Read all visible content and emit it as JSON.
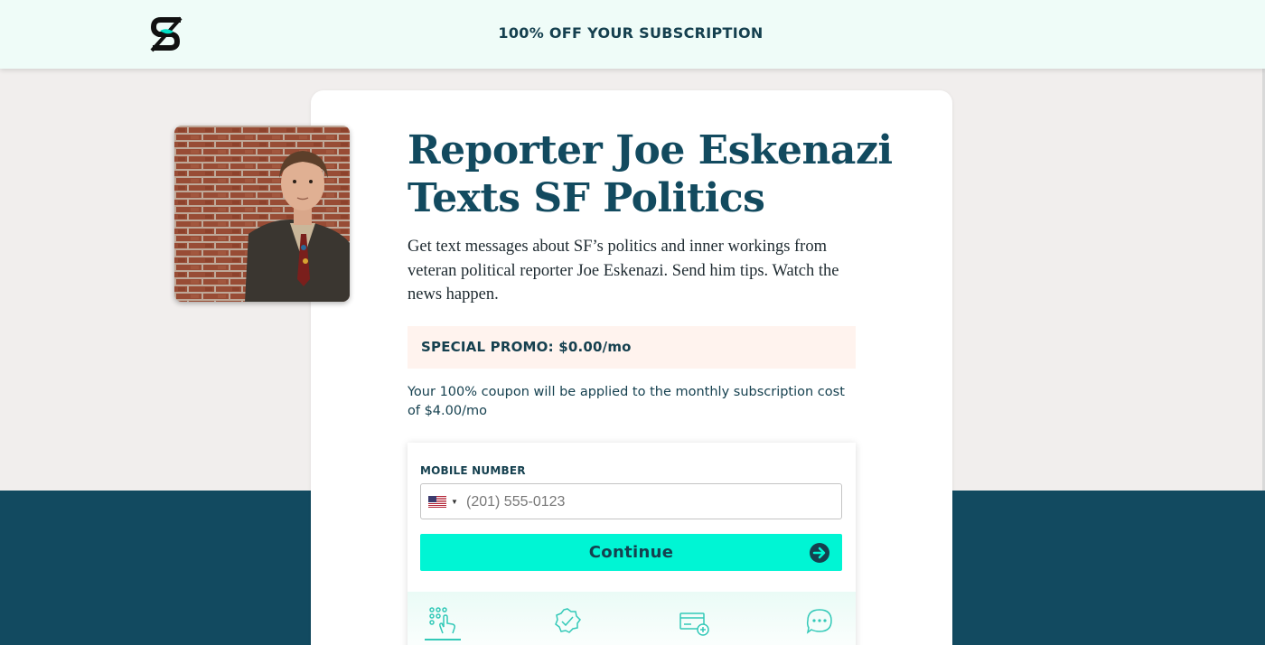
{
  "header": {
    "logo_icon": "s-logo-icon",
    "banner_text": "100% OFF YOUR SUBSCRIPTION"
  },
  "hero": {
    "photo": "reporter-portrait",
    "title_line1": "Reporter Joe Eskenazi",
    "title_line2": "Texts SF Politics",
    "description": "Get text messages about SF’s politics and inner workings from veteran political reporter Joe Eskenazi. Send him tips. Watch the news happen."
  },
  "promo": {
    "label": "SPECIAL PROMO: $0.00/mo",
    "coupon_text": "Your 100% coupon will be applied to the monthly subscription cost of $4.00/mo"
  },
  "form": {
    "label": "MOBILE NUMBER",
    "country_flag": "us-flag-icon",
    "phone_placeholder": "(201) 555-0123",
    "phone_value": "",
    "continue_label": "Continue",
    "continue_icon": "arrow-right-circle-icon"
  },
  "steps": [
    {
      "icon": "keypad-tap-icon",
      "active": true
    },
    {
      "icon": "verified-badge-icon",
      "active": false
    },
    {
      "icon": "add-card-icon",
      "active": false
    },
    {
      "icon": "chat-bubble-icon",
      "active": false
    }
  ],
  "colors": {
    "brand_dark": "#124a5f",
    "accent": "#00f5d4",
    "header_bg": "#effcf8",
    "page_bg": "#f1eeed",
    "band_bg": "#124a60",
    "promo_bg": "#fff3ee"
  }
}
